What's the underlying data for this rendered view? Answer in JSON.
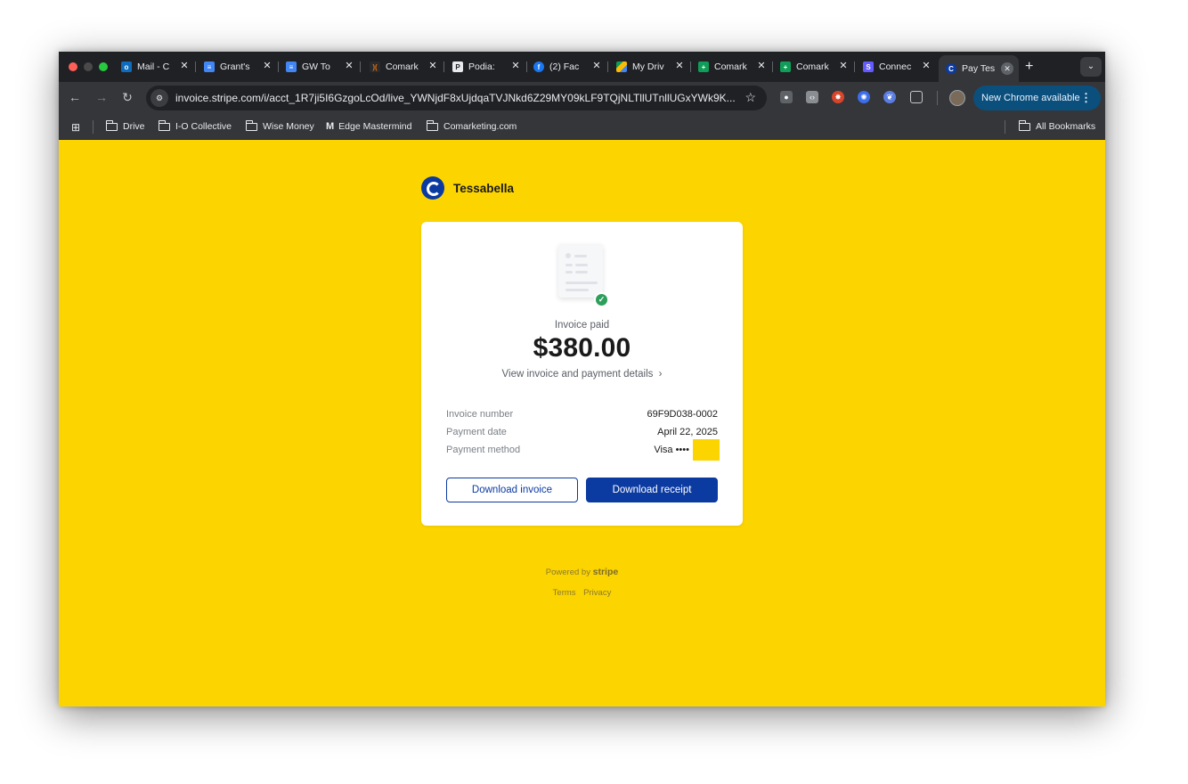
{
  "browser": {
    "tabs": [
      {
        "title": "Mail - C",
        "icon": "outlook-icon",
        "color": "#0f6cbd"
      },
      {
        "title": "Grant's",
        "icon": "docs-icon",
        "color": "#4285f4"
      },
      {
        "title": "GW To",
        "icon": "docs-icon",
        "color": "#4285f4"
      },
      {
        "title": "Comark",
        "icon": "comarketing-icon",
        "color": "#e8710a"
      },
      {
        "title": "Podia:",
        "icon": "podia-icon",
        "color": "#e8eaed"
      },
      {
        "title": "(2) Fac",
        "icon": "facebook-icon",
        "color": "#1877f2"
      },
      {
        "title": "My Driv",
        "icon": "drive-icon",
        "color": "#fbbc04"
      },
      {
        "title": "Comark",
        "icon": "sheets-icon",
        "color": "#0f9d58"
      },
      {
        "title": "Comark",
        "icon": "sheets-icon",
        "color": "#0f9d58"
      },
      {
        "title": "Connec",
        "icon": "stripe-icon",
        "color": "#635bff"
      },
      {
        "title": "Pay Tes",
        "icon": "tessabella-icon",
        "color": "#0b3aa1",
        "active": true
      }
    ],
    "url": "invoice.stripe.com/i/acct_1R7ji5I6GzgoLcOd/live_YWNjdF8xUjdqaTVJNkd6Z29MY09kLF9TQjNLTllUTnllUGxYWk9K...",
    "update_label": "New Chrome available",
    "bookmarks": [
      {
        "label": "Drive",
        "icon": "folder-icon"
      },
      {
        "label": "I-O Collective",
        "icon": "folder-icon"
      },
      {
        "label": "Wise Money",
        "icon": "folder-icon"
      },
      {
        "label": "Edge Mastermind",
        "icon": "edge-mastermind-icon"
      },
      {
        "label": "Comarketing.com",
        "icon": "folder-icon"
      }
    ],
    "all_bookmarks_label": "All Bookmarks"
  },
  "page": {
    "merchant_name": "Tessabella",
    "status": "Invoice paid",
    "amount": "$380.00",
    "details_link": "View invoice and payment details",
    "rows": [
      {
        "label": "Invoice number",
        "value": "69F9D038-0002"
      },
      {
        "label": "Payment date",
        "value": "April 22, 2025"
      },
      {
        "label": "Payment method",
        "value": "Visa ••••"
      }
    ],
    "download_invoice": "Download invoice",
    "download_receipt": "Download receipt",
    "powered_by": "Powered by",
    "stripe_wordmark": "stripe",
    "terms": "Terms",
    "privacy": "Privacy",
    "colors": {
      "background": "#fcd400",
      "brand": "#0b3aa1",
      "success": "#2e9e5b"
    }
  }
}
